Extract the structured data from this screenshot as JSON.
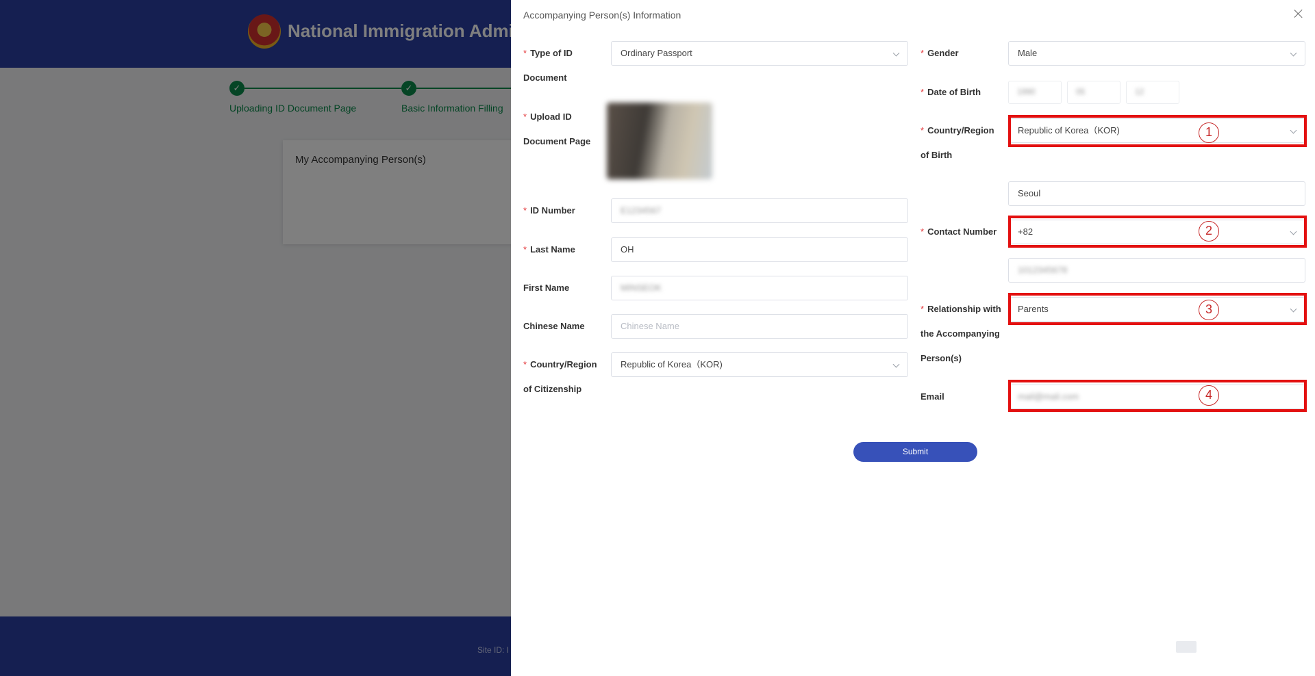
{
  "background": {
    "site_title": "National Immigration Admi",
    "steps": [
      "Uploading ID Document Page",
      "Basic Information Filling"
    ],
    "card_title": "My Accompanying Person(s)",
    "footer_text": "Site ID: I"
  },
  "drawer": {
    "title": "Accompanying Person(s) Information",
    "submit_label": "Submit",
    "left_fields": {
      "type_of_id": {
        "label_line1": "Type of ID",
        "label_line2": "Document",
        "value": "Ordinary Passport"
      },
      "upload_id": {
        "label_line1": "Upload ID",
        "label_line2": "Document Page"
      },
      "id_number": {
        "label": "ID Number",
        "value": "E1234567"
      },
      "last_name": {
        "label": "Last Name",
        "value": "OH"
      },
      "first_name": {
        "label": "First Name",
        "value": "MINSEOK"
      },
      "chinese_name": {
        "label": "Chinese Name",
        "placeholder": "Chinese Name"
      },
      "citizenship": {
        "label_line1": "Country/Region",
        "label_line2": "of Citizenship",
        "value": "Republic of Korea（KOR)"
      }
    },
    "right_fields": {
      "gender": {
        "label": "Gender",
        "value": "Male"
      },
      "dob": {
        "label": "Date of Birth",
        "parts": [
          "1990",
          "05",
          "12"
        ]
      },
      "birth_country": {
        "label_line1": "Country/Region",
        "label_line2": "of Birth",
        "value": "Republic of Korea（KOR)"
      },
      "birth_city": {
        "value": "Seoul"
      },
      "contact": {
        "label": "Contact Number",
        "code": "+82",
        "number": "1012345678"
      },
      "relationship": {
        "label_line1": "Relationship with",
        "label_line2": "the Accompanying",
        "label_line3": "Person(s)",
        "value": "Parents"
      },
      "email": {
        "label": "Email",
        "value": "mail@mail.com"
      }
    },
    "annotations": [
      "1",
      "2",
      "3",
      "4"
    ]
  },
  "colors": {
    "header_blue": "#2b3fa3",
    "accent_blue": "#3751b9",
    "step_green": "#0a8a4a",
    "required_red": "#e4393c",
    "highlight_red": "#e31010"
  }
}
